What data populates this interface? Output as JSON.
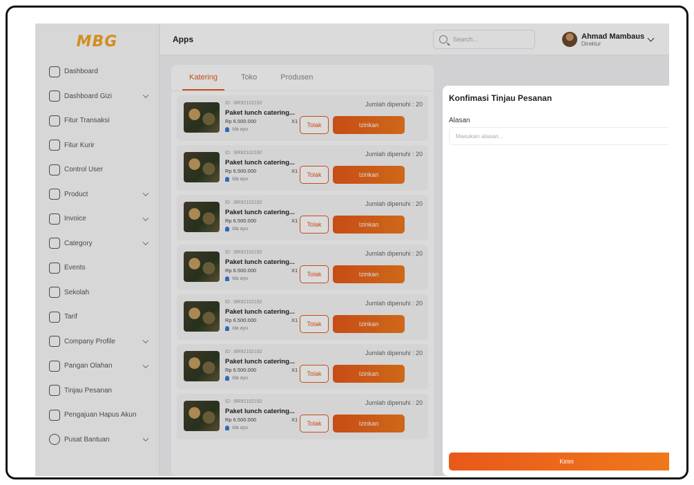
{
  "app": {
    "logo": "MBG",
    "title": "Apps"
  },
  "search": {
    "placeholder": "Search..."
  },
  "profile": {
    "name": "Ahmad Mambaus",
    "role": "Direktur"
  },
  "sidebar": {
    "items": [
      {
        "label": "Dashboard",
        "icon": "home-icon",
        "has_children": false
      },
      {
        "label": "Dashboard Gizi",
        "icon": "nutrition-icon",
        "has_children": true
      },
      {
        "label": "Fitur Transaksi",
        "icon": "receipt-icon",
        "has_children": false
      },
      {
        "label": "Fitur Kurir",
        "icon": "truck-icon",
        "has_children": false
      },
      {
        "label": "Control User",
        "icon": "users-icon",
        "has_children": false
      },
      {
        "label": "Product",
        "icon": "gift-icon",
        "has_children": true
      },
      {
        "label": "Invoice",
        "icon": "document-icon",
        "has_children": true
      },
      {
        "label": "Category",
        "icon": "grid-icon",
        "has_children": true
      },
      {
        "label": "Events",
        "icon": "calendar-icon",
        "has_children": false
      },
      {
        "label": "Sekolah",
        "icon": "school-icon",
        "has_children": false
      },
      {
        "label": "Tarif",
        "icon": "tariff-icon",
        "has_children": false
      },
      {
        "label": "Company Profile",
        "icon": "company-icon",
        "has_children": true
      },
      {
        "label": "Pangan Olahan",
        "icon": "food-icon",
        "has_children": true
      },
      {
        "label": "Tinjau Pesanan",
        "icon": "clipboard-icon",
        "has_children": false
      },
      {
        "label": "Pengajuan Hapus Akun",
        "icon": "user-delete-icon",
        "has_children": false
      },
      {
        "label": "Pusat Bantuan",
        "icon": "help-icon",
        "has_children": true
      }
    ]
  },
  "tabs": [
    {
      "label": "Katering",
      "active": true
    },
    {
      "label": "Toko",
      "active": false
    },
    {
      "label": "Produsen",
      "active": false
    }
  ],
  "orders": [
    {
      "id": "ID : BR92102192",
      "name": "Paket lunch catering...",
      "price": "Rp 6.500.000",
      "qty": "X1",
      "user": "Ida ayu",
      "fulfilled": "Jumlah dipenuhi  :  20",
      "reject_label": "Tolak",
      "approve_label": "Izinkan"
    },
    {
      "id": "ID : BR92102192",
      "name": "Paket lunch catering...",
      "price": "Rp 6.500.000",
      "qty": "X1",
      "user": "Ida ayu",
      "fulfilled": "Jumlah dipenuhi  :  20",
      "reject_label": "Tolak",
      "approve_label": "Izinkan"
    },
    {
      "id": "ID : BR92102192",
      "name": "Paket lunch catering...",
      "price": "Rp 6.500.000",
      "qty": "X1",
      "user": "Ida ayu",
      "fulfilled": "Jumlah dipenuhi  :  20",
      "reject_label": "Tolak",
      "approve_label": "Izinkan"
    },
    {
      "id": "ID : BR92102192",
      "name": "Paket lunch catering...",
      "price": "Rp 6.500.000",
      "qty": "X1",
      "user": "Ida ayu",
      "fulfilled": "Jumlah dipenuhi  :  20",
      "reject_label": "Tolak",
      "approve_label": "Izinkan"
    },
    {
      "id": "ID : BR92102192",
      "name": "Paket lunch catering...",
      "price": "Rp 6.500.000",
      "qty": "X1",
      "user": "Ida ayu",
      "fulfilled": "Jumlah dipenuhi  :  20",
      "reject_label": "Tolak",
      "approve_label": "Izinkan"
    },
    {
      "id": "ID : BR92102192",
      "name": "Paket lunch catering...",
      "price": "Rp 6.500.000",
      "qty": "X1",
      "user": "Ida ayu",
      "fulfilled": "Jumlah dipenuhi  :  20",
      "reject_label": "Tolak",
      "approve_label": "Izinkan"
    },
    {
      "id": "ID : BR92102192",
      "name": "Paket lunch catering...",
      "price": "Rp 6.500.000",
      "qty": "X1",
      "user": "Ida ayu",
      "fulfilled": "Jumlah dipenuhi  :  20",
      "reject_label": "Tolak",
      "approve_label": "Izinkan"
    }
  ],
  "modal": {
    "title": "Konfimasi Tinjau Pesanan",
    "reason_label": "Alasan",
    "reason_placeholder": "Masukan alasan...",
    "reason_value": "",
    "submit_label": "Kirim"
  },
  "colors": {
    "accent": "#e8591a",
    "logo": "#f5a623"
  }
}
